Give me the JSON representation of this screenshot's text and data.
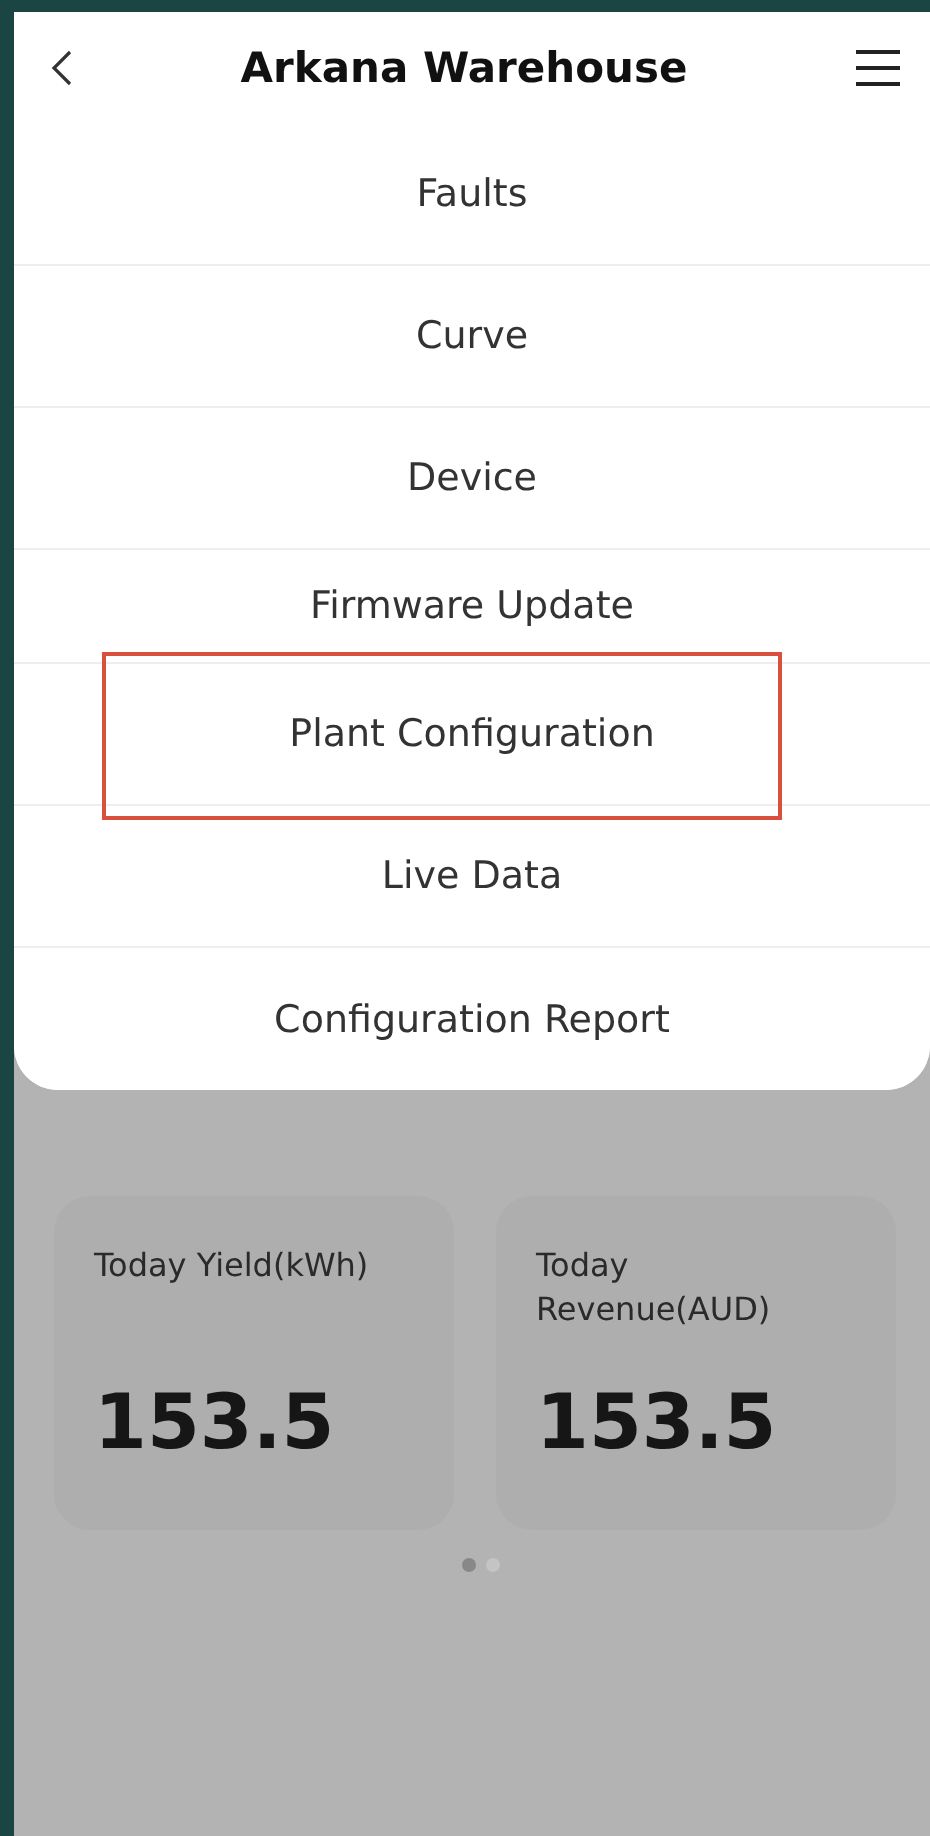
{
  "header": {
    "title": "Arkana Warehouse"
  },
  "menu": [
    {
      "label": "Faults",
      "highlighted": false
    },
    {
      "label": "Curve",
      "highlighted": false
    },
    {
      "label": "Device",
      "highlighted": false
    },
    {
      "label": "Firmware Update",
      "highlighted": false
    },
    {
      "label": "Plant Configuration",
      "highlighted": true
    },
    {
      "label": "Live Data",
      "highlighted": false
    },
    {
      "label": "Configuration Report",
      "highlighted": false
    }
  ],
  "stats": [
    {
      "label": "Today Yield(kWh)",
      "value": "153.5"
    },
    {
      "label": "Today Revenue(AUD)",
      "value": "153.5"
    }
  ],
  "pager": [
    {
      "selected": true
    },
    {
      "selected": false
    }
  ]
}
